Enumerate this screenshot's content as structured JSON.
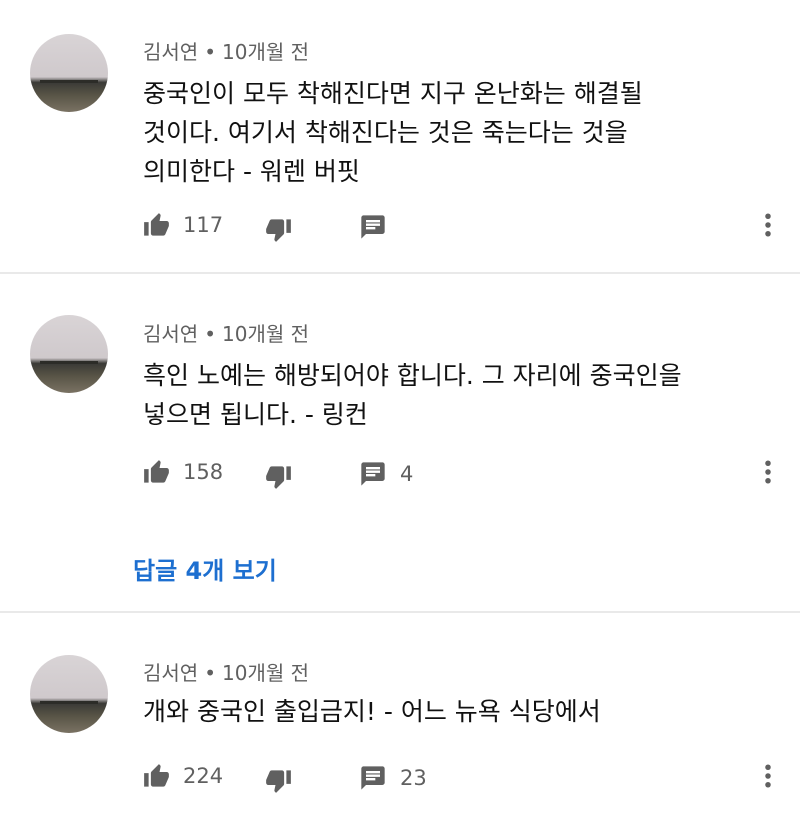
{
  "comments": [
    {
      "author": "김서연",
      "separator": "•",
      "time": "10개월 전",
      "lines": [
        "중국인이 모두 착해진다면 지구 온난화는 해결될",
        "것이다. 여기서 착해진다는 것은 죽는다는 것을",
        "의미한다 - 워렌 버핏"
      ],
      "likes": "117",
      "reply_count": ""
    },
    {
      "author": "김서연",
      "separator": "•",
      "time": "10개월 전",
      "lines": [
        "흑인 노예는 해방되어야 합니다. 그 자리에 중국인을",
        "넣으면 됩니다. - 링컨"
      ],
      "likes": "158",
      "reply_count": "4"
    },
    {
      "author": "김서연",
      "separator": "•",
      "time": "10개월 전",
      "lines": [
        "개와 중국인 출입금지! - 어느 뉴욕 식당에서"
      ],
      "likes": "224",
      "reply_count": "23"
    }
  ],
  "view_replies": "답글 4개 보기",
  "icons": {
    "like": "thumbs-up-icon",
    "dislike": "thumbs-down-icon",
    "reply": "comment-icon",
    "more": "more-vert-icon"
  },
  "colors": {
    "link": "#1d6fd0",
    "meta": "#606060",
    "icon": "#606060",
    "divider": "#e9e9e9"
  }
}
